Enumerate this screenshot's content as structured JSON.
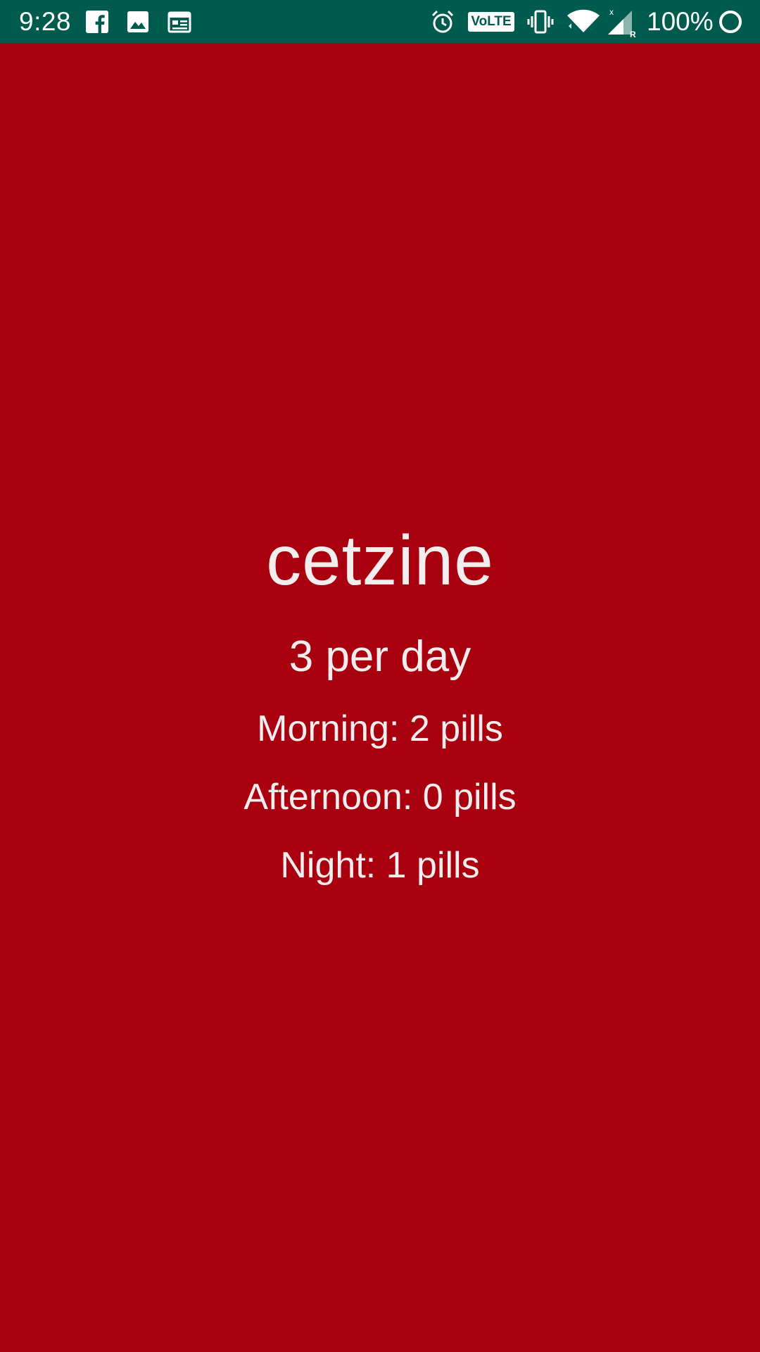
{
  "status_bar": {
    "time": "9:28",
    "left_icons": [
      "facebook-icon",
      "image-icon",
      "news-icon"
    ],
    "right_icons": [
      "alarm-icon",
      "volte-icon",
      "vibrate-icon",
      "wifi-icon",
      "signal-icon",
      "battery-icon"
    ],
    "volte_label": "VoLTE",
    "battery": "100%",
    "background_color": "#005b4f"
  },
  "medication": {
    "name": "cetzine",
    "frequency": "3 per day",
    "morning": "Morning: 2 pills",
    "afternoon": "Afternoon: 0 pills",
    "night": "Night: 1 pills"
  },
  "colors": {
    "background": "#a8000f",
    "text": "#f3eded"
  }
}
